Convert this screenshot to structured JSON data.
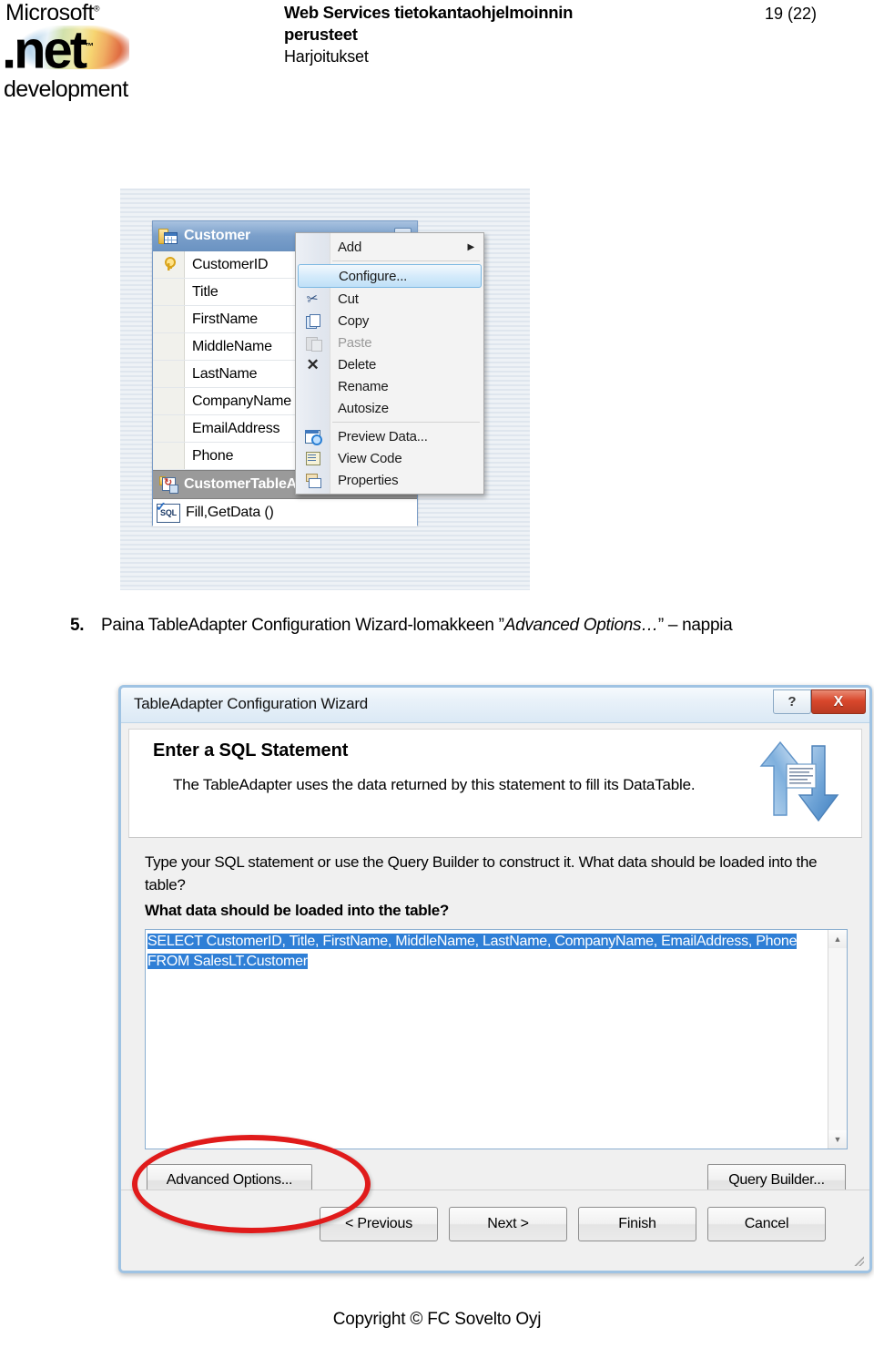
{
  "header": {
    "logo": {
      "microsoft": "Microsoft",
      "net": ".net",
      "development": "development",
      "tm": "®",
      "net_tm": "™"
    },
    "title_line1": "Web Services tietokantaohjelmoinnin",
    "title_line2": "perusteet",
    "subtitle": "Harjoitukset",
    "page_number": "19 (22)"
  },
  "figure_dataset": {
    "table_card": {
      "title": "Customer",
      "collapse_icon": "chevron-up-icon",
      "table_icon": "dataset-table-icon",
      "columns": [
        {
          "name": "CustomerID",
          "is_key": true
        },
        {
          "name": "Title",
          "is_key": false
        },
        {
          "name": "FirstName",
          "is_key": false
        },
        {
          "name": "MiddleName",
          "is_key": false
        },
        {
          "name": "LastName",
          "is_key": false
        },
        {
          "name": "CompanyName",
          "is_key": false
        },
        {
          "name": "EmailAddress",
          "is_key": false
        },
        {
          "name": "Phone",
          "is_key": false
        }
      ],
      "adapter_label": "CustomerTableAdapter",
      "query_label": "Fill,GetData ()",
      "sql_icon_text": "SQL"
    },
    "context_menu": {
      "items": [
        {
          "label": "Add",
          "icon": "",
          "has_submenu": true,
          "disabled": false,
          "highlighted": false,
          "separator_after": true
        },
        {
          "label": "Configure...",
          "icon": "",
          "has_submenu": false,
          "disabled": false,
          "highlighted": true,
          "separator_after": false
        },
        {
          "label": "Cut",
          "icon": "scissors-icon",
          "has_submenu": false,
          "disabled": false,
          "highlighted": false,
          "separator_after": false
        },
        {
          "label": "Copy",
          "icon": "copy-icon",
          "has_submenu": false,
          "disabled": false,
          "highlighted": false,
          "separator_after": false
        },
        {
          "label": "Paste",
          "icon": "paste-icon",
          "has_submenu": false,
          "disabled": true,
          "highlighted": false,
          "separator_after": false
        },
        {
          "label": "Delete",
          "icon": "delete-x-icon",
          "has_submenu": false,
          "disabled": false,
          "highlighted": false,
          "separator_after": false
        },
        {
          "label": "Rename",
          "icon": "",
          "has_submenu": false,
          "disabled": false,
          "highlighted": false,
          "separator_after": false
        },
        {
          "label": "Autosize",
          "icon": "",
          "has_submenu": false,
          "disabled": false,
          "highlighted": false,
          "separator_after": true
        },
        {
          "label": "Preview Data...",
          "icon": "preview-data-icon",
          "has_submenu": false,
          "disabled": false,
          "highlighted": false,
          "separator_after": false
        },
        {
          "label": "View Code",
          "icon": "view-code-icon",
          "has_submenu": false,
          "disabled": false,
          "highlighted": false,
          "separator_after": false
        },
        {
          "label": "Properties",
          "icon": "properties-icon",
          "has_submenu": false,
          "disabled": false,
          "highlighted": false,
          "separator_after": false
        }
      ],
      "submenu_arrow": "▶"
    }
  },
  "step": {
    "number": "5.",
    "text_before": "Paina TableAdapter Configuration Wizard-lomakkeen ”",
    "emphasis": "Advanced Options…",
    "text_after": "” – nappia"
  },
  "wizard": {
    "title": "TableAdapter Configuration Wizard",
    "help_button": "?",
    "close_button": "X",
    "banner_icon": "two-arrows-document-icon",
    "banner_heading": "Enter a SQL Statement",
    "banner_sub": "The TableAdapter uses the data returned by this statement to fill its DataTable.",
    "prompt_text": "Type your SQL statement or use the Query Builder to construct it. What data should be loaded into the table?",
    "prompt_bold": "What data should be loaded into the table?",
    "sql_statement": "SELECT CustomerID, Title, FirstName, MiddleName, LastName, CompanyName, EmailAddress, Phone FROM SalesLT.Customer",
    "scrollbar_up": "▲",
    "scrollbar_down": "▼",
    "advanced_options_button": "Advanced Options...",
    "query_builder_button": "Query Builder...",
    "footer_buttons": [
      "< Previous",
      "Next >",
      "Finish",
      "Cancel"
    ],
    "annotation_color": "#e01b1b",
    "selection_color": "#2f7fd6"
  },
  "footer": {
    "copyright": "Copyright © FC Sovelto Oyj"
  }
}
